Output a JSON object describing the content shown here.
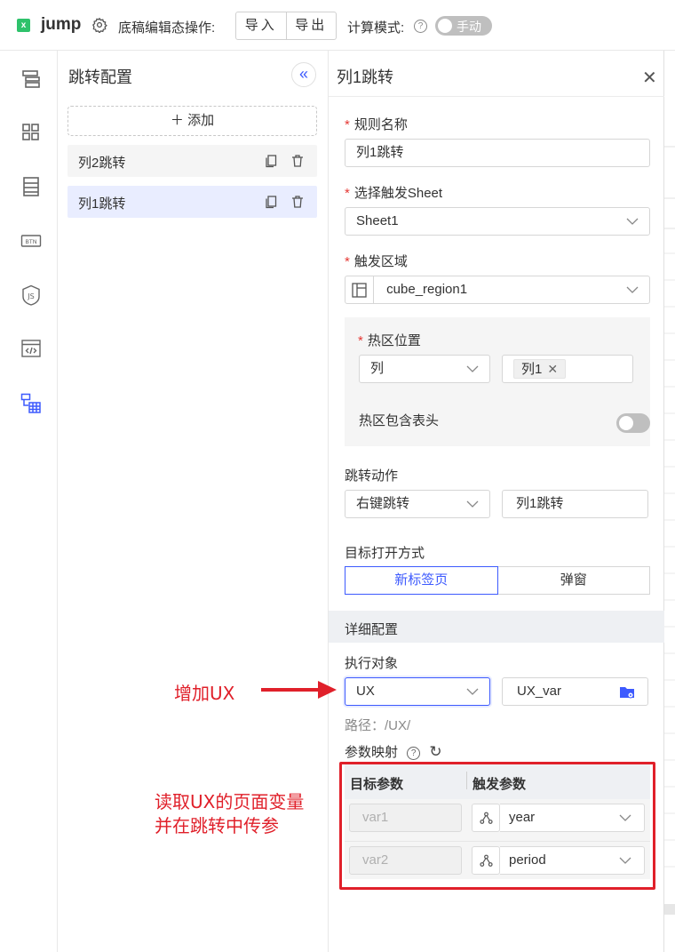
{
  "topbar": {
    "app_name": "jump",
    "draft_label": "底稿编辑态操作:",
    "import_label": "导入",
    "export_label": "导出",
    "calc_mode_label": "计算模式:",
    "calc_mode_value": "手动",
    "help_glyph": "?"
  },
  "rail": {
    "icons": [
      "layout-icon",
      "grid-icon",
      "list-icon",
      "button-icon",
      "js-icon",
      "code-window-icon",
      "jump-table-icon"
    ]
  },
  "list_panel": {
    "title": "跳转配置",
    "add_label": "＋ 添加",
    "items": [
      {
        "label": "列2跳转",
        "active": false
      },
      {
        "label": "列1跳转",
        "active": true
      }
    ]
  },
  "config": {
    "title": "列1跳转",
    "rule_name_label": "规则名称",
    "rule_name_value": "列1跳转",
    "trigger_sheet_label": "选择触发Sheet",
    "trigger_sheet_value": "Sheet1",
    "trigger_area_label": "触发区域",
    "trigger_area_value": "cube_region1",
    "hotzone_label": "热区位置",
    "hotzone_type": "列",
    "hotzone_tag": "列1",
    "hotzone_header_label": "热区包含表头",
    "hotzone_header_on": false,
    "jump_action_label": "跳转动作",
    "jump_action_value": "右键跳转",
    "jump_action_name": "列1跳转",
    "open_mode_label": "目标打开方式",
    "open_mode_options": [
      "新标签页",
      "弹窗"
    ],
    "open_mode_selected": "新标签页",
    "detail_label": "详细配置",
    "exec_target_label": "执行对象",
    "exec_target_value": "UX",
    "exec_var_value": "UX_var",
    "path_label": "路径：/UX/",
    "param_map_label": "参数映射",
    "param_table": {
      "headers": [
        "目标参数",
        "触发参数"
      ],
      "rows": [
        {
          "target": "var1",
          "trigger": "year"
        },
        {
          "target": "var2",
          "trigger": "period"
        }
      ]
    }
  },
  "annotations": {
    "arrow_text": "增加UX",
    "box_text_line1": "读取UX的页面变量",
    "box_text_line2": "并在跳转中传参"
  },
  "colors": {
    "accent": "#3d5afe",
    "annotation_red": "#e0202a",
    "required_star": "#e53935"
  }
}
